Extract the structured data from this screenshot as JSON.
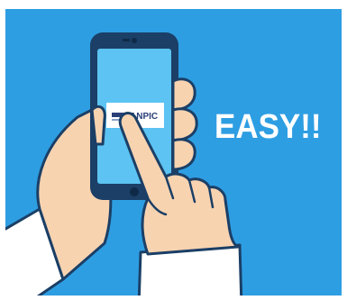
{
  "headline": "EASY!!",
  "phone_logo": {
    "text": "ANPIC"
  },
  "colors": {
    "background": "#2e9ee3",
    "phone_frame": "#1b3f66",
    "screen": "#5cc3f2",
    "skin": "#f8d3b0",
    "skin_outline": "#1b3f66",
    "sleeve": "#ffffff"
  },
  "icons": [
    "smartphone",
    "left-hand-holding-phone",
    "right-hand-pointing-finger"
  ]
}
